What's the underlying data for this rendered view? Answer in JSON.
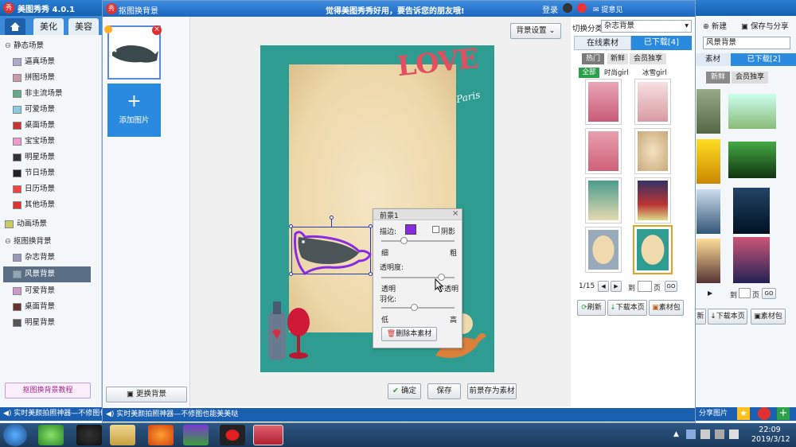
{
  "app": {
    "title": "美图秀秀 4.0.1",
    "promo": "觉得美图秀秀好用，要告诉您的朋友哦!",
    "login": "登录",
    "feedback": "提意见"
  },
  "main_tabs": [
    "美化",
    "美容"
  ],
  "tree": [
    {
      "label": "静态场景",
      "level": 0
    },
    {
      "label": "逼真场景",
      "level": 1
    },
    {
      "label": "拼图场景",
      "level": 1
    },
    {
      "label": "非主流场景",
      "level": 1
    },
    {
      "label": "可爱场景",
      "level": 1
    },
    {
      "label": "桌面场景",
      "level": 1
    },
    {
      "label": "宝宝场景",
      "level": 1
    },
    {
      "label": "明星场景",
      "level": 1
    },
    {
      "label": "节日场景",
      "level": 1
    },
    {
      "label": "日历场景",
      "level": 1
    },
    {
      "label": "其他场景",
      "level": 1
    },
    {
      "label": "动画场景",
      "level": 0
    },
    {
      "label": "抠图换背景",
      "level": 0
    },
    {
      "label": "杂志背景",
      "level": 1
    },
    {
      "label": "风景背景",
      "level": 1,
      "selected": true
    },
    {
      "label": "可爱背景",
      "level": 1
    },
    {
      "label": "桌面背景",
      "level": 1
    },
    {
      "label": "明星背景",
      "level": 1
    }
  ],
  "tutorial_button": "抠图换背景教程",
  "status_text": "实时美颜拍照神器—不修图也能美美哒",
  "back_right": {
    "new": "新建",
    "save_share": "保存与分享",
    "category": "风景背景",
    "tab_online": "素材",
    "tab_downloaded": "已下载[2]",
    "filter_new": "新鲜",
    "filter_vip": "会员独享",
    "page_to": "到",
    "page_unit": "页",
    "go": "GO",
    "refresh": "新",
    "download_page": "下载本页",
    "pack": "素材包",
    "share": "分享图片"
  },
  "dialog": {
    "title": "抠图换背景",
    "add_image": "添加图片",
    "change_bg": "更换背景",
    "bg_settings": "背景设置",
    "confirm": "确定",
    "save": "保存",
    "save_as_material": "前景存为素材"
  },
  "foreground_panel": {
    "title": "前景1",
    "border_label": "描边:",
    "shadow_label": "阴影",
    "thin": "细",
    "thick": "粗",
    "opacity_label": "透明度:",
    "transparent": "透明",
    "opaque": "不透明",
    "feather_label": "羽化:",
    "low": "低",
    "high": "高",
    "delete": "删除本素材",
    "border_color": "#8a2be2",
    "border_value": 0.3,
    "opacity_value": 0.82,
    "feather_value": 0.45
  },
  "materials": {
    "switch_label": "切换分类",
    "category": "杂志背景",
    "tab_online": "在线素材",
    "tab_downloaded": "已下载[4]",
    "filters": [
      "热门",
      "新鲜",
      "会员独享"
    ],
    "subfilters": [
      "全部",
      "时尚girl",
      "冰雪girl"
    ],
    "page": "1/15",
    "page_to": "到",
    "page_unit": "页",
    "go": "GO",
    "refresh": "刷新",
    "download_page": "下载本页",
    "pack": "素材包"
  },
  "poster_text": {
    "love": "LOVE",
    "paris": "Paris"
  },
  "taskbar": {
    "time": "22:09",
    "date": "2019/3/12"
  }
}
